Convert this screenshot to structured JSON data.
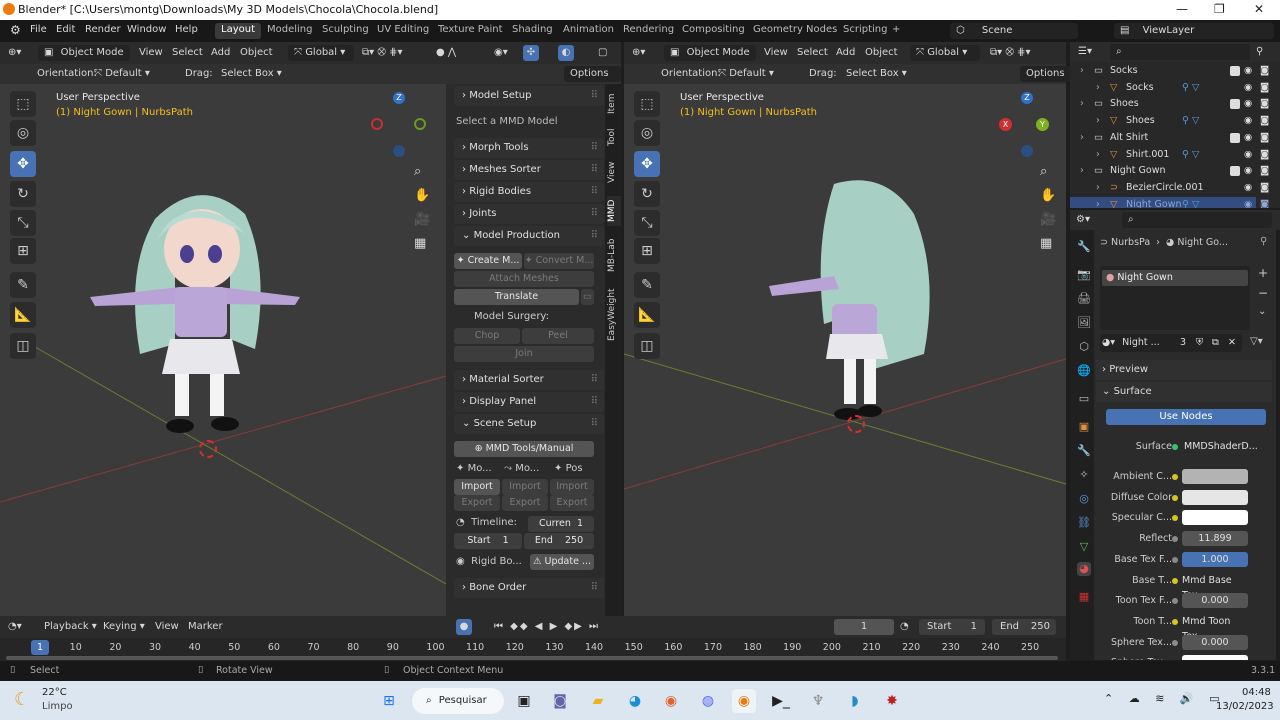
{
  "window": {
    "title": "Blender* [C:\\Users\\montg\\Downloads\\My 3D Models\\Chocola\\Chocola.blend]",
    "minimize": "—",
    "maximize": "❐",
    "close": "✕"
  },
  "menubar": {
    "items": [
      "File",
      "Edit",
      "Render",
      "Window",
      "Help"
    ],
    "workspaces": [
      "Layout",
      "Modeling",
      "Sculpting",
      "UV Editing",
      "Texture Paint",
      "Shading",
      "Animation",
      "Rendering",
      "Compositing",
      "Geometry Nodes",
      "Scripting"
    ],
    "add_workspace": "+",
    "scene": "Scene",
    "view_layer": "ViewLayer"
  },
  "viewport_left": {
    "mode": "Object Mode",
    "menus": [
      "View",
      "Select",
      "Add",
      "Object"
    ],
    "transform": "Global",
    "orientation_label": "Orientation:",
    "orientation_value": "Default",
    "drag_label": "Drag:",
    "drag_value": "Select Box",
    "options": "Options",
    "title": "User Perspective",
    "subtitle": "(1) Night Gown | NurbsPath"
  },
  "viewport_right": {
    "mode": "Object Mode",
    "menus": [
      "View",
      "Select",
      "Add",
      "Object"
    ],
    "transform": "Global",
    "orientation_label": "Orientation:",
    "orientation_value": "Default",
    "drag_label": "Drag:",
    "drag_value": "Select Box",
    "options": "Options",
    "title": "User Perspective",
    "subtitle": "(1) Night Gown | NurbsPath"
  },
  "gizmo": {
    "z": "Z",
    "x": "X",
    "y": "Y"
  },
  "npanel": {
    "tabs": [
      "Item",
      "Tool",
      "View",
      "MMD",
      "MB-Lab",
      "EasyWeight"
    ],
    "model_setup": "Model Setup",
    "select_model": "Select a MMD Model",
    "morph_tools": "Morph Tools",
    "meshes_sorter": "Meshes Sorter",
    "rigid_bodies": "Rigid Bodies",
    "joints": "Joints",
    "model_production": "Model Production",
    "create_model": "Create M...",
    "convert_model": "Convert M...",
    "attach_meshes": "Attach Meshes",
    "translate": "Translate",
    "model_surgery": "Model Surgery:",
    "chop": "Chop",
    "peel": "Peel",
    "join": "Join",
    "material_sorter": "Material Sorter",
    "display_panel": "Display Panel",
    "scene_setup": "Scene Setup",
    "mmd_tools_manual": "MMD Tools/Manual",
    "mo1": "Mo...",
    "mo2": "Mo...",
    "pos": "Pos",
    "import": "Import",
    "export": "Export",
    "timeline_label": "Timeline:",
    "current_label": "Curren",
    "current_value": "1",
    "start_label": "Start",
    "start_value": "1",
    "end_label": "End",
    "end_value": "250",
    "rigid_body_label": "Rigid Bo...",
    "update": "Update ...",
    "bone_order": "Bone Order"
  },
  "outliner": {
    "rows": [
      {
        "name": "Socks",
        "indent": 0,
        "icon": "collection"
      },
      {
        "name": "Socks",
        "indent": 1,
        "icon": "object"
      },
      {
        "name": "Shoes",
        "indent": 0,
        "icon": "collection"
      },
      {
        "name": "Shoes",
        "indent": 1,
        "icon": "object"
      },
      {
        "name": "Alt Shirt",
        "indent": 0,
        "icon": "collection"
      },
      {
        "name": "Shirt.001",
        "indent": 1,
        "icon": "object"
      },
      {
        "name": "Night Gown",
        "indent": 0,
        "icon": "collection"
      },
      {
        "name": "BezierCircle.001",
        "indent": 1,
        "icon": "curve"
      },
      {
        "name": "Night Gown",
        "indent": 1,
        "icon": "object"
      }
    ]
  },
  "properties": {
    "breadcrumb_object": "NurbsPa",
    "breadcrumb_material": "Night Go...",
    "material_slot": "Night Gown",
    "material_name": "Night ...",
    "users": "3",
    "preview": "Preview",
    "surface_section": "Surface",
    "use_nodes": "Use Nodes",
    "surface_label": "Surface",
    "surface_value": "MMDShaderD...",
    "rows": [
      {
        "label": "Ambient C...",
        "value": "",
        "kind": "color",
        "color": "#b3b3b3"
      },
      {
        "label": "Diffuse Color",
        "value": "",
        "kind": "color",
        "color": "#e6e6e6"
      },
      {
        "label": "Specular C...",
        "value": "",
        "kind": "color",
        "color": "#ffffff"
      },
      {
        "label": "Reflect",
        "value": "11.899",
        "kind": "num"
      },
      {
        "label": "Base Tex F...",
        "value": "1.000",
        "kind": "slider"
      },
      {
        "label": "Base T...",
        "value": "Mmd Base Tex",
        "kind": "text"
      },
      {
        "label": "Toon Tex F...",
        "value": "0.000",
        "kind": "num"
      },
      {
        "label": "Toon T...",
        "value": "Mmd Toon Tex",
        "kind": "text"
      },
      {
        "label": "Sphere Tex...",
        "value": "0.000",
        "kind": "num"
      },
      {
        "label": "Sphere Tex...",
        "value": "",
        "kind": "color",
        "color": "#ffffff"
      }
    ]
  },
  "timeline": {
    "menus": [
      "Playback",
      "Keying",
      "View",
      "Marker"
    ],
    "current_frame": "1",
    "start_label": "Start",
    "start_value": "1",
    "end_label": "End",
    "end_value": "250",
    "ticks": [
      "1",
      "10",
      "20",
      "30",
      "40",
      "50",
      "60",
      "70",
      "80",
      "90",
      "100",
      "110",
      "120",
      "130",
      "140",
      "150",
      "160",
      "170",
      "180",
      "190",
      "200",
      "210",
      "220",
      "230",
      "240",
      "250"
    ]
  },
  "statusbar": {
    "select": "Select",
    "rotate": "Rotate View",
    "context": "Object Context Menu",
    "version": "3.3.1"
  },
  "taskbar": {
    "temperature": "22°C",
    "weather": "Limpo",
    "search": "Pesquisar",
    "time": "04:48",
    "date": "13/02/2023"
  },
  "colors": {
    "accent": "#4772b3",
    "viewport_bg": "#3b3b3b",
    "subtitle": "#f0c020"
  }
}
